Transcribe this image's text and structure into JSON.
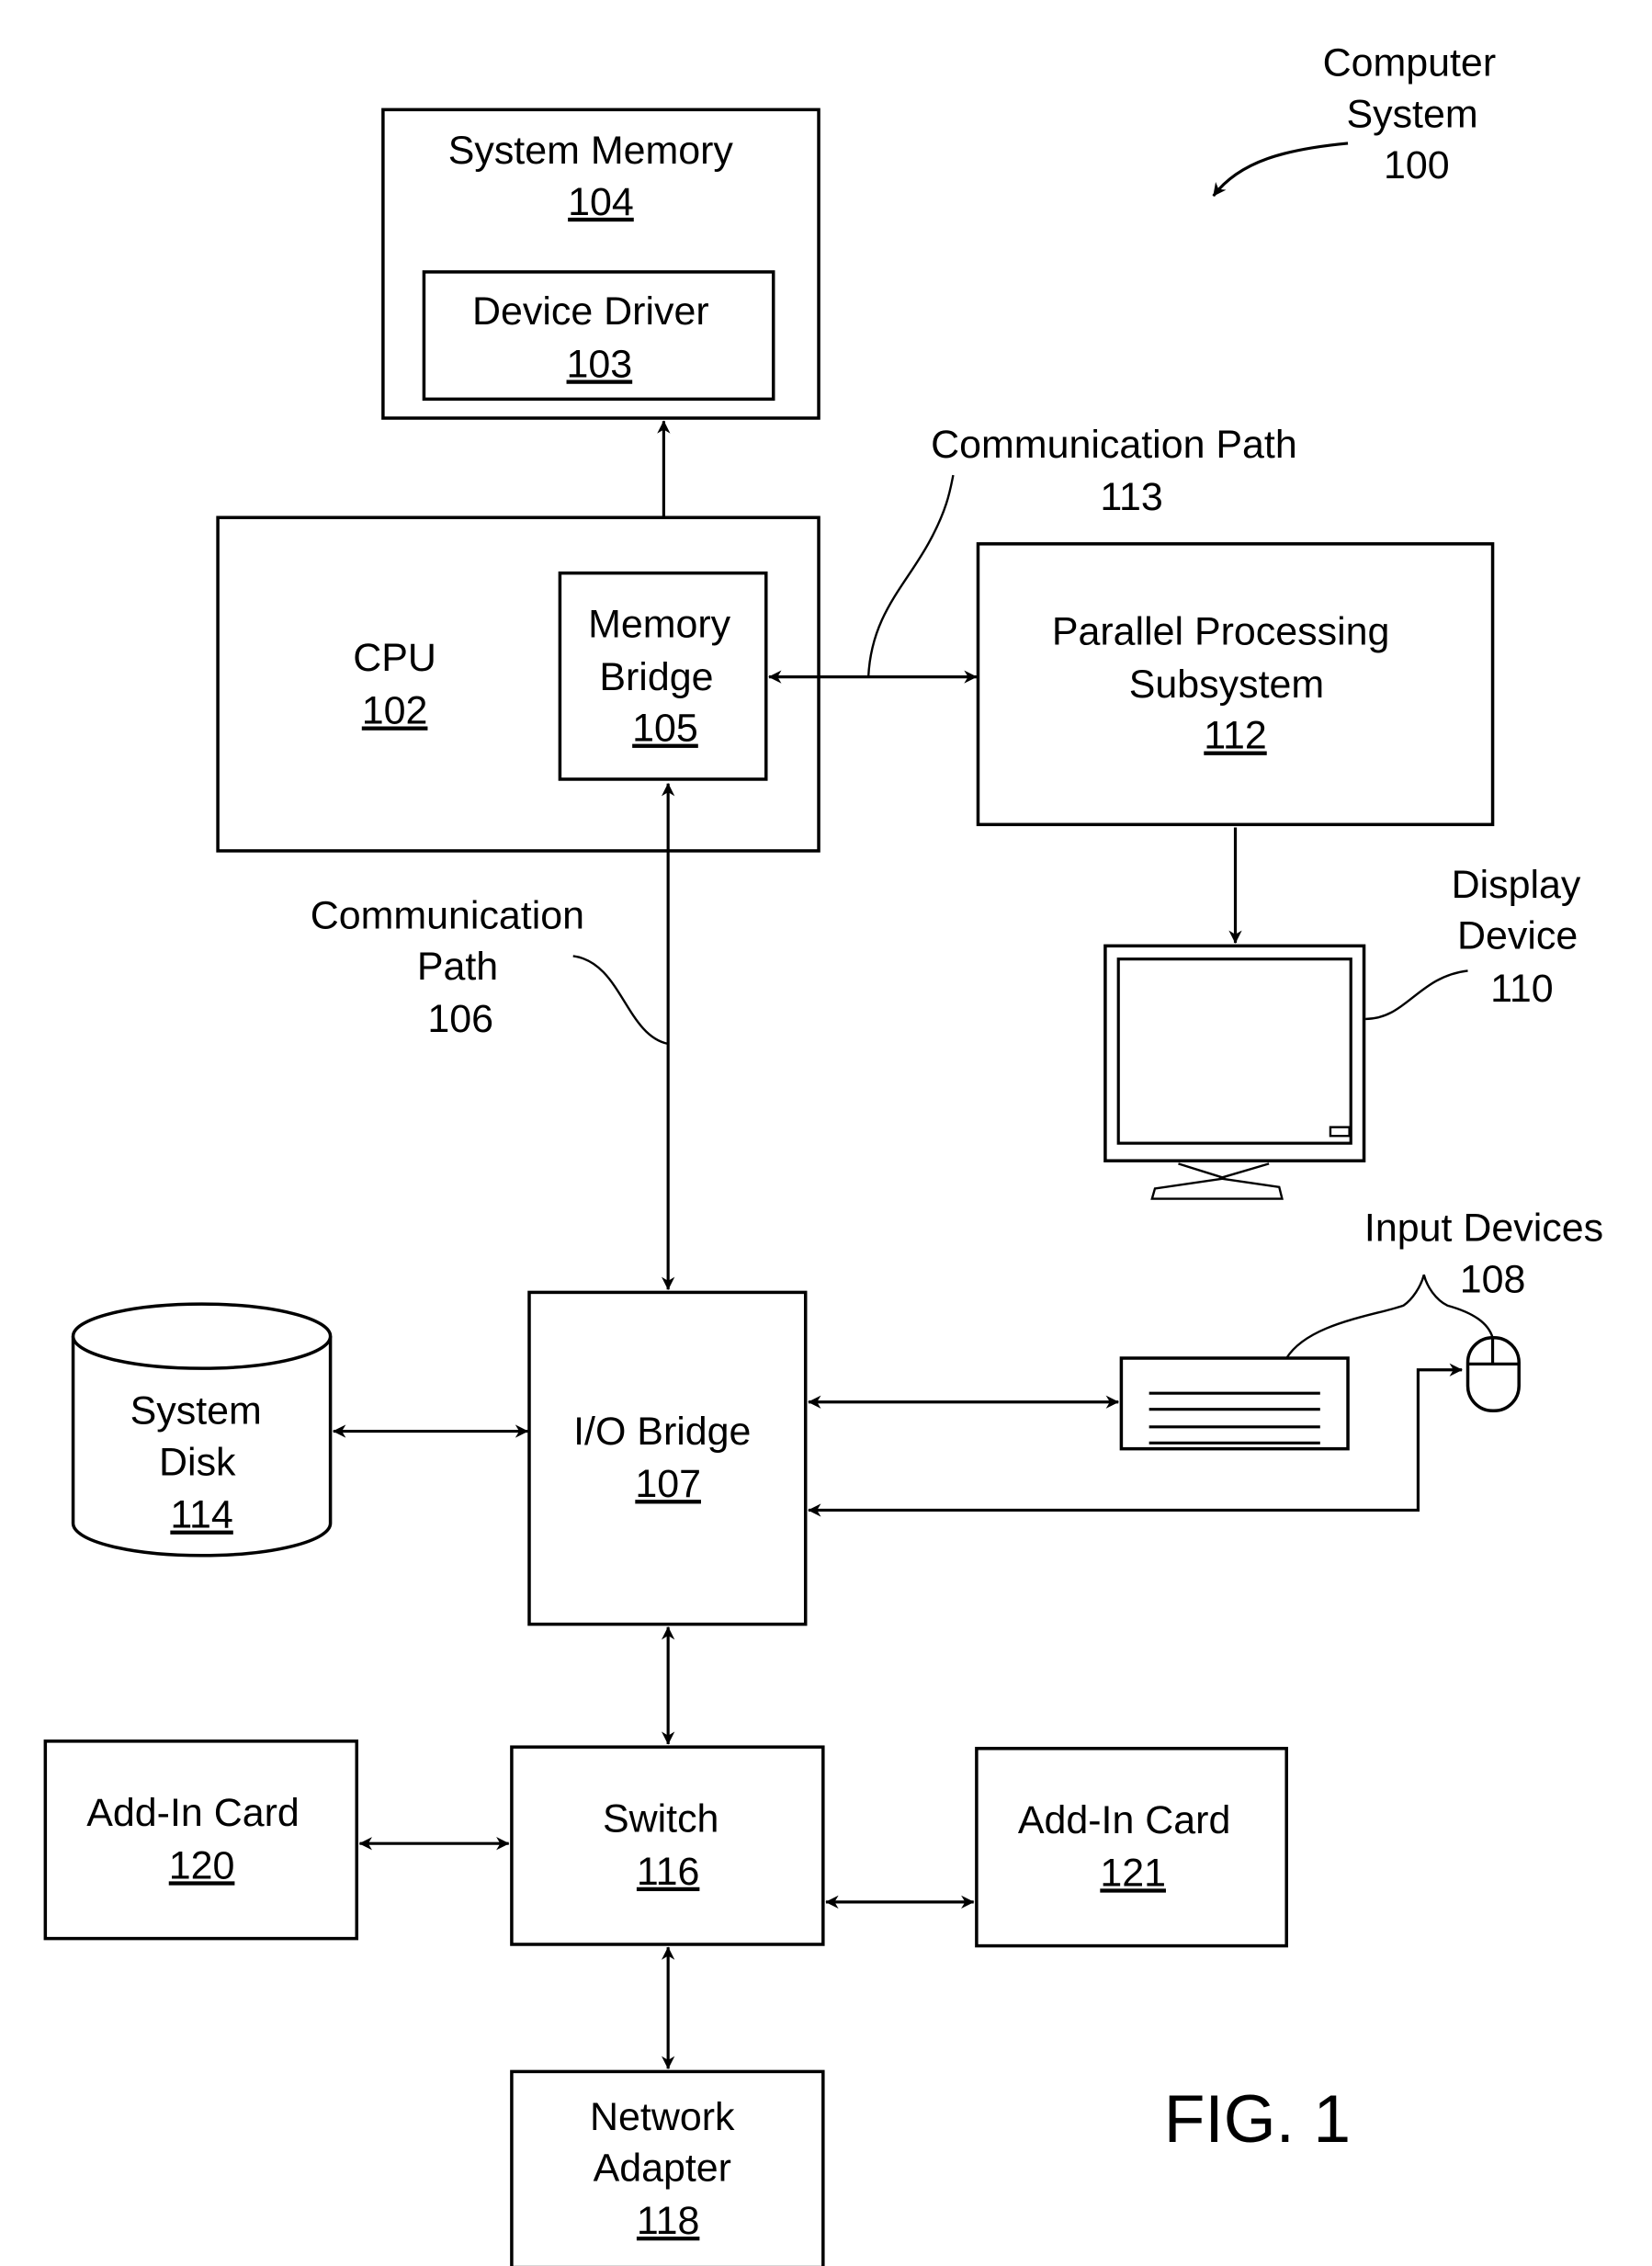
{
  "figure": {
    "title": "FIG. 1",
    "system_label": [
      "Computer",
      "System",
      "100"
    ]
  },
  "components": {
    "system_memory": {
      "name": "System Memory",
      "ref": "104"
    },
    "device_driver": {
      "name": "Device Driver",
      "ref": "103"
    },
    "cpu": {
      "name": "CPU",
      "ref": "102"
    },
    "memory_bridge": {
      "name": [
        "Memory",
        "Bridge"
      ],
      "ref": "105"
    },
    "parallel_processing": {
      "name": [
        "Parallel Processing",
        "Subsystem"
      ],
      "ref": "112"
    },
    "display_device": {
      "name": [
        "Display",
        "Device"
      ],
      "ref": "110"
    },
    "io_bridge": {
      "name": "I/O Bridge",
      "ref": "107"
    },
    "system_disk": {
      "name": [
        "System",
        "Disk"
      ],
      "ref": "114"
    },
    "input_devices": {
      "name": "Input Devices",
      "ref": "108"
    },
    "switch": {
      "name": "Switch",
      "ref": "116"
    },
    "add_in_card_120": {
      "name": "Add-In Card",
      "ref": "120"
    },
    "add_in_card_121": {
      "name": "Add-In Card",
      "ref": "121"
    },
    "network_adapter": {
      "name": [
        "Network",
        "Adapter"
      ],
      "ref": "118"
    }
  },
  "paths": {
    "comm_path_113": {
      "name": "Communication Path",
      "ref": "113"
    },
    "comm_path_106": {
      "name": [
        "Communication",
        "Path"
      ],
      "ref": "106"
    }
  }
}
